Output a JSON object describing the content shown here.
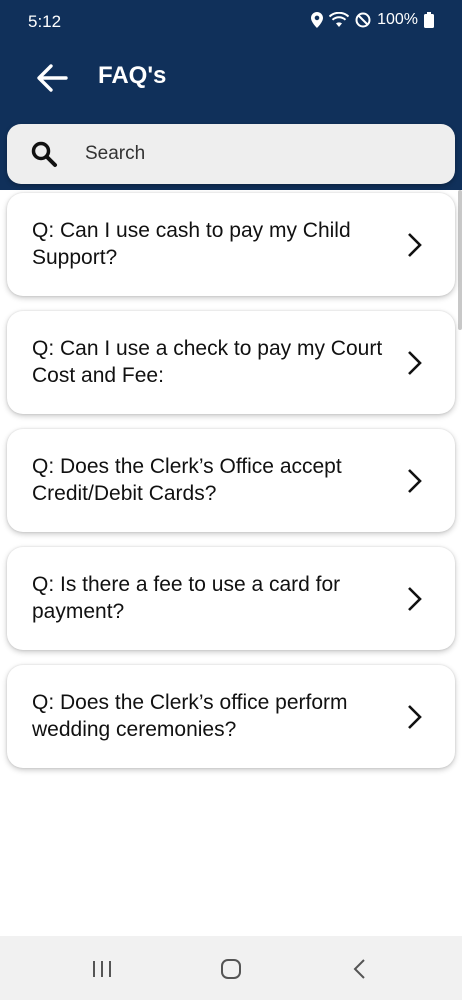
{
  "status_bar": {
    "time": "5:12",
    "battery": "100%",
    "icons": [
      "location-icon",
      "wifi-icon",
      "do-not-disturb-icon",
      "battery-icon"
    ]
  },
  "app_bar": {
    "title": "FAQ's",
    "back_icon": "arrow-back-icon"
  },
  "search": {
    "placeholder": "Search",
    "value": "",
    "icon": "search-icon"
  },
  "faqs": [
    {
      "question": "Q: Can I use cash to pay my Child Support?"
    },
    {
      "question": "Q: Can I use a check to pay my Court Cost and Fee:"
    },
    {
      "question": "Q: Does the Clerk’s Office accept Credit/Debit Cards?"
    },
    {
      "question": "Q: Is there a fee to use a card for payment?"
    },
    {
      "question": "Q: Does the Clerk’s office perform wedding ceremonies?"
    }
  ],
  "nav_bar": {
    "icons": [
      "recent-apps-icon",
      "home-icon",
      "back-icon"
    ]
  },
  "colors": {
    "header": "#10305a",
    "card": "#ffffff",
    "search_bg": "#eeeeee"
  }
}
